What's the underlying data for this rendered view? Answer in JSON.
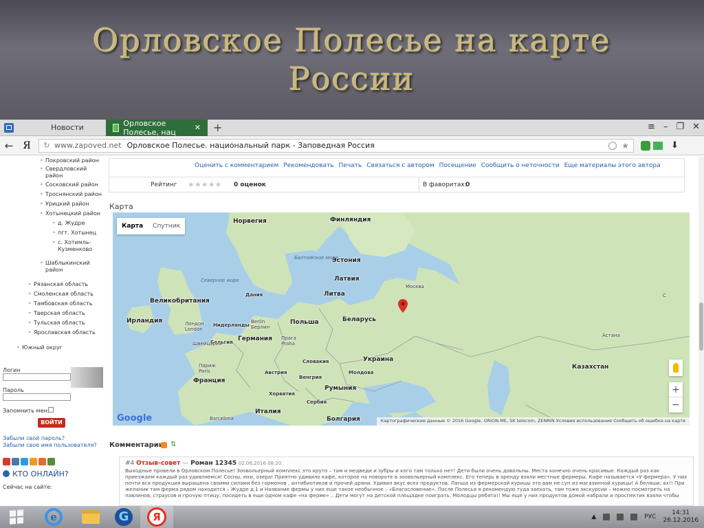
{
  "slide": {
    "title_line1": "Орловское Полесье на карте",
    "title_line2": "России"
  },
  "browser": {
    "tabs": [
      {
        "label": "Новости",
        "active": false
      },
      {
        "label": "Орловское Полесье, нац",
        "active": true
      }
    ],
    "new_tab": "+",
    "menu_icon": "≡",
    "window_controls": [
      "–",
      "❐",
      "✕"
    ],
    "back_icon": "←",
    "yandex_logo": "Я",
    "url_domain": "www.zapoved.net",
    "url_title": "Орловское Полесье. национальный парк - Заповедная Россия",
    "tab_close": "✕"
  },
  "sidebar": {
    "items": [
      "Покровский район",
      "Свердловский район",
      "Сосковский район",
      "Троснянский район",
      "Урицкий район",
      "Хотынецкий район",
      "д. Жудре",
      "пгт. Хотынец",
      "с. Хотимль-Кузменково",
      "Шаблыкинский район",
      "Рязанская область",
      "Смоленская область",
      "Тамбовская область",
      "Тверская область",
      "Тульская область",
      "Ярославская область",
      "Южный округ"
    ],
    "login_label": "Логин",
    "password_label": "Пароль",
    "remember_label": "Запомнить меня",
    "login_button": "ВОЙТИ",
    "forgot_password": "Забыли свой пароль?",
    "forgot_username": "Забыли свое имя пользователя?",
    "social_colors": [
      "#d93b2b",
      "#4a76a8",
      "#2a9be0",
      "#f39a1e",
      "#e8692a",
      "#5a8a3a"
    ],
    "online_title": "КТО ОНЛАЙН?",
    "online_sub": "Сейчас на сайте:"
  },
  "article": {
    "actions": [
      "Оценить с комментарием",
      "Рекомендовать",
      "Печать",
      "Связаться с автором",
      "Посещение",
      "Сообщить о неточности",
      "Еще материалы этого автора"
    ],
    "rating_label": "Рейтинг",
    "rating_stars": 0,
    "votes": "0 оценок",
    "favorites_label": "В фаворитах:",
    "favorites_value": "0"
  },
  "map": {
    "heading": "Карта",
    "type_map": "Карта",
    "type_satellite": "Спутник",
    "labels": {
      "norway": "Норвегия",
      "finland": "Финляндия",
      "estonia": "Эстония",
      "latvia": "Латвия",
      "lithuania": "Литва",
      "belarus": "Беларусь",
      "poland": "Польша",
      "germany": "Германия",
      "uk": "Великобритания",
      "ireland": "Ирландия",
      "netherlands": "Нидерланды",
      "belgium": "Бельгия",
      "france": "Франция",
      "ukraine": "Украина",
      "kazakhstan": "Казахстан",
      "moldova": "Молдова",
      "romania": "Румыния",
      "slovakia": "Словакия",
      "hungary": "Венгрия",
      "austria": "Австрия",
      "croatia": "Хорватия",
      "serbia": "Сербия",
      "bulgaria": "Болгария",
      "italy": "Италия",
      "denmark": "Дания",
      "baltic_sea": "Балтийское море",
      "north_sea": "Северное море",
      "moscow": "Москва",
      "astana": "Астана",
      "london": "Лондон London",
      "berlin": "Berlin Берлин",
      "prague": "Прага Praha",
      "paris": "Париж Paris",
      "barcelona": "Barcelona",
      "swiss": "Швейцария",
      "s_label": "С"
    },
    "google": "Google",
    "attribution": "Картографические данные © 2016 Google, ORION-ME, SK telecom, ZENRIN   Условия использования   Сообщить об ошибке на карте",
    "zoom_in": "+",
    "zoom_out": "−",
    "pin_color": "#d93025"
  },
  "comments": {
    "heading": "Комментарии",
    "item": {
      "num": "#4",
      "title": "Отзыв-совет",
      "author": "Роман 12345",
      "date": "02.06.2016 08:20",
      "text": "Выходные провели в Орловском Полесье! Зоовольерный комплекс это круто – там и медведи и зубры и кого там только нет! Дети были очень довольны. Места конечно очень красивые. Каждый раз как приезжаем каждый раз удивляемся! Сосны, мхи, озера! Приятно удивило кафе, которое на повороте в зоовольерный комплекс. Его теперь в аренду взяли местные фермеры. Кафе называется «У фермера». У них почти вся продукция выращена своими силами без гормонов , антибиотиков и прочей дряни. Удивил вкус всех продуктов. Лапша из фермерской курицы это вам не суп из магазинной курицы! А беляши, ах!! При желании там ферма рядом находится – Жудре д.1 и Название фермы у них еще такое необычное – «Благословение». После Полесья я рекомендую туда заехать, там тоже экскурсии – можно посмотреть на павлинов, страусов и прочую птицу, посидеть в еще одном кафе «на ферме» .. Дети могут на детской площадке поиграть. Молодцы ребята!! Мы еще у них продуктов домой набрали и проспектик взяли чтобы"
    }
  },
  "taskbar": {
    "lang": "РУС",
    "time": "14:31",
    "date": "26.12.2016",
    "ie_glyph": "e",
    "app3_glyph": "G",
    "ybrowser_glyph": "Я"
  }
}
